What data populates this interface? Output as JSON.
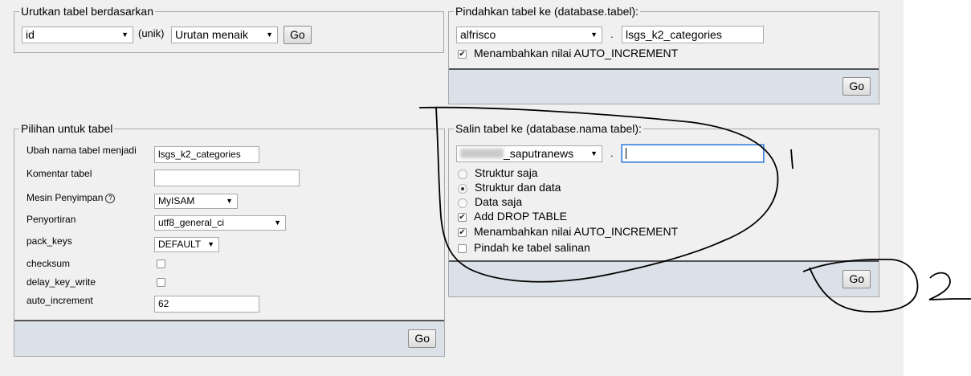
{
  "sort_table": {
    "legend": "Urutkan tabel berdasarkan",
    "column_value": "id",
    "unique_label": "(unik)",
    "order_value": "Urutan menaik",
    "go_label": "Go"
  },
  "move_table": {
    "legend": "Pindahkan tabel ke (database.tabel):",
    "database_value": "alfrisco",
    "separator": ".",
    "table_value": "lsgs_k2_categories",
    "auto_increment_label": "Menambahkan nilai AUTO_INCREMENT",
    "auto_increment_checked": true,
    "go_label": "Go"
  },
  "table_options": {
    "legend": "Pilihan untuk tabel",
    "rows": [
      {
        "label": "Ubah nama tabel menjadi",
        "value": "lsgs_k2_categories"
      },
      {
        "label": "Komentar tabel",
        "value": ""
      },
      {
        "label": "Mesin Penyimpan",
        "value": "MyISAM"
      },
      {
        "label": "Penyortiran",
        "value": "utf8_general_ci"
      },
      {
        "label": "pack_keys",
        "value": "DEFAULT"
      },
      {
        "label": "checksum",
        "checked": false
      },
      {
        "label": "delay_key_write",
        "checked": false
      },
      {
        "label": "auto_increment",
        "value": "62"
      }
    ],
    "help_icon": "question-circle-icon",
    "go_label": "Go"
  },
  "copy_table": {
    "legend": "Salin tabel ke (database.nama tabel):",
    "database_value": "_saputranews",
    "separator": ".",
    "table_value": "",
    "options": [
      {
        "label": "Struktur saja",
        "checked": false
      },
      {
        "label": "Struktur dan data",
        "checked": true
      },
      {
        "label": "Data saja",
        "checked": false
      }
    ],
    "checkboxes": [
      {
        "label": "Add DROP TABLE",
        "checked": true
      },
      {
        "label": "Menambahkan nilai AUTO_INCREMENT",
        "checked": true
      },
      {
        "label": "Pindah ke tabel salinan",
        "checked": false
      }
    ],
    "go_label": "Go"
  },
  "annotations": {
    "mark_1": "|",
    "mark_2": "2"
  },
  "colors": {
    "page_bg": "#f0f0f0",
    "footer_bg": "#dbe1e8",
    "border": "#a8a8a8"
  }
}
